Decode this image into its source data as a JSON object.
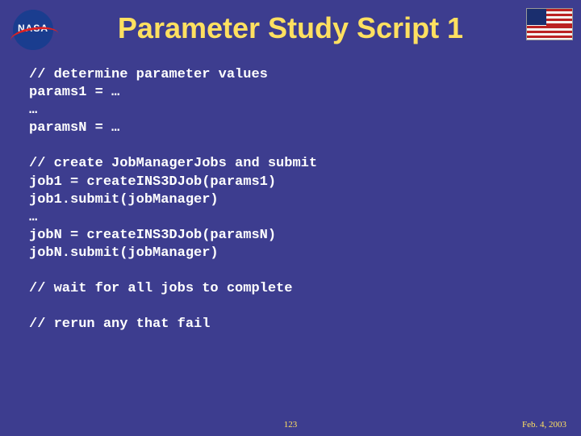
{
  "logo": {
    "text": "NASA"
  },
  "title": "Parameter Study Script 1",
  "code_lines": [
    "// determine parameter values",
    "params1 = …",
    "…",
    "paramsN = …",
    "",
    "// create JobManagerJobs and submit",
    "job1 = createINS3DJob(params1)",
    "job1.submit(jobManager)",
    "…",
    "jobN = createINS3DJob(paramsN)",
    "jobN.submit(jobManager)",
    "",
    "// wait for all jobs to complete",
    "",
    "// rerun any that fail"
  ],
  "page_number": "123",
  "date": "Feb. 4, 2003"
}
